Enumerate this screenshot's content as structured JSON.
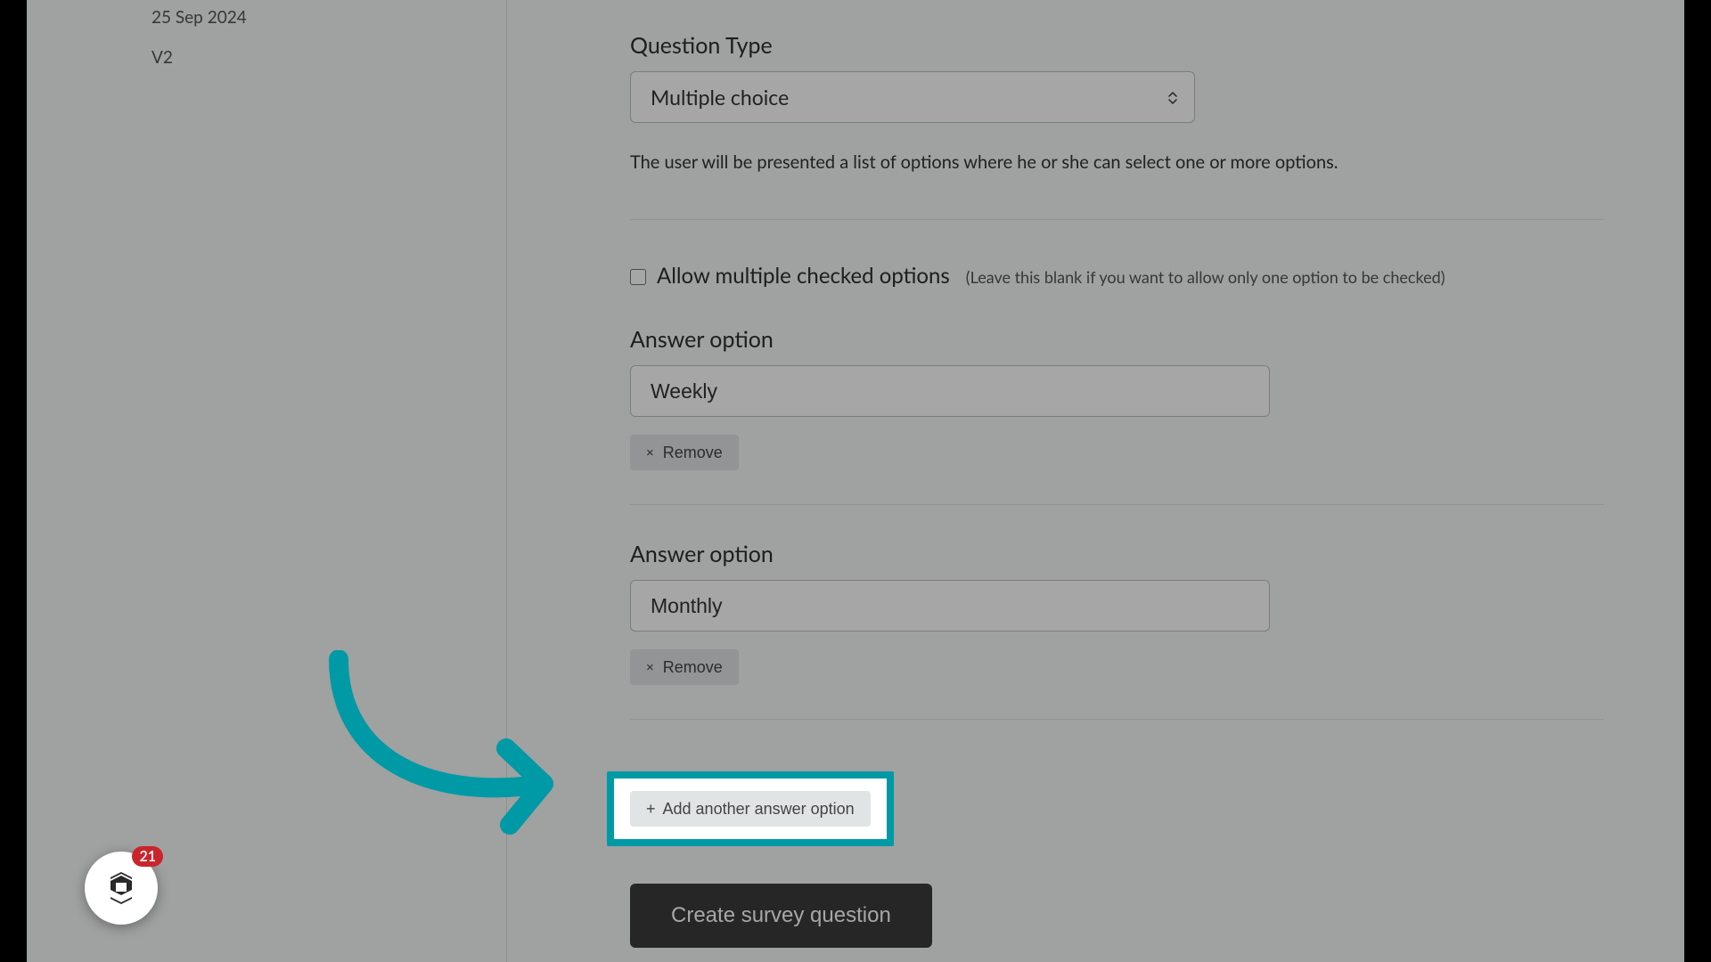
{
  "sidebar": {
    "date": "25 Sep 2024",
    "version": "V2"
  },
  "form": {
    "question_type_label": "Question Type",
    "question_type_value": "Multiple choice",
    "question_type_help": "The user will be presented a list of options where he or she can select one or more options.",
    "allow_multiple_label": "Allow multiple checked options",
    "allow_multiple_hint": "(Leave this blank if you want to allow only one option to be checked)",
    "allow_multiple_checked": false,
    "answer_option_label": "Answer option",
    "options": [
      {
        "value": "Weekly"
      },
      {
        "value": "Monthly"
      }
    ],
    "remove_label": "Remove",
    "remove_icon": "×",
    "add_option_label": "Add another answer option",
    "add_option_icon": "+",
    "submit_label": "Create survey question"
  },
  "widget": {
    "badge_count": "21"
  },
  "colors": {
    "accent": "#009aa6",
    "primary_btn": "#3b3b3b",
    "badge": "#c9252c"
  }
}
